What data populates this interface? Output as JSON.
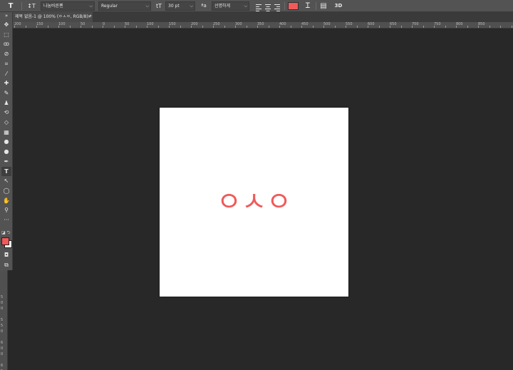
{
  "options_bar": {
    "tool_icon": "T",
    "orientation_icon": "↕T",
    "font_family": "나눔바른펜",
    "font_style": "Regular",
    "size_icon": "tT",
    "font_size": "30 pt",
    "aa_icon": "ªa",
    "antialias": "선명하게",
    "text_color": "#f05a5a",
    "warp_icon": "Ꮖ",
    "panels_icon": "▤",
    "threed_label": "3D"
  },
  "document_tab": {
    "title": "제목 없음-1 @ 100% (ㅇㅅㅇ, RGB/8) *",
    "close": "×"
  },
  "ruler_h_labels": [
    "200",
    "150",
    "100",
    "50",
    "0",
    "50",
    "100",
    "150",
    "200",
    "250",
    "300",
    "350",
    "400",
    "450",
    "500",
    "550",
    "600",
    "650",
    "700",
    "750",
    "800",
    "850"
  ],
  "ruler_v_labels": [
    "5",
    "0",
    "0",
    "5",
    "5",
    "0",
    "6",
    "0",
    "0",
    "6",
    "5",
    "0"
  ],
  "toolbar": {
    "collapse": "»",
    "tools": [
      "✥",
      "⬚",
      "ꝏ",
      "⊘",
      "⌗",
      "⁄",
      "✚",
      "✎",
      "♟",
      "⟲",
      "◇",
      "▦",
      "●",
      "●",
      "✒",
      "T",
      "↖",
      "◯",
      "✋",
      "⚲",
      "···"
    ],
    "fg_color": "#f05a5a",
    "bg_color": "#ffffff",
    "quickmask_icon": "◘",
    "screenmode_icon": "⧉"
  },
  "canvas": {
    "text": "ㅇㅅㅇ",
    "text_color": "#f05a5a"
  }
}
